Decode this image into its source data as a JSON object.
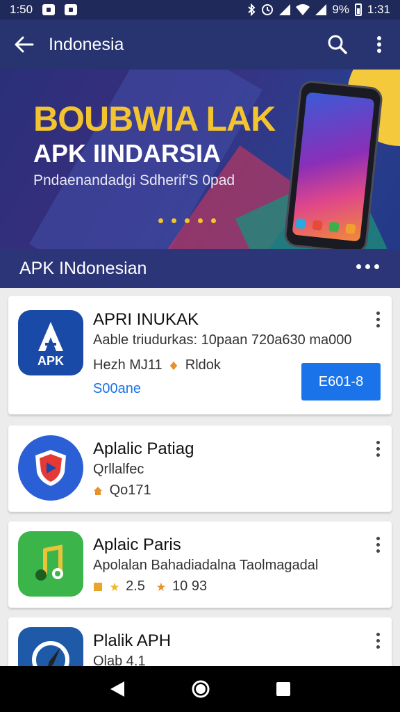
{
  "status_bar": {
    "time_left": "1:50",
    "battery": "9%",
    "time_right": "1:31"
  },
  "app_bar": {
    "title": "Indonesia"
  },
  "banner": {
    "title_line1": "BOUBWIA LAK",
    "title_line2": "APK IINDARSIA",
    "subtitle": "Pndaenandadgi Sdherif'S 0pad"
  },
  "section": {
    "title": "APK INdonesian"
  },
  "apps": [
    {
      "name": "APRI INUKAK",
      "icon_text": "APK",
      "icon": "apk-logo-icon",
      "line1": "Aable triudurkas: 10paan 720a630 ma000",
      "line2": "Hezh MJ11",
      "line2_extra": "Rldok",
      "link": "S00ane",
      "button_label": "E601-8"
    },
    {
      "name": "Aplalic Patiag",
      "icon": "shield-play-icon",
      "line1": "Qrllalfec",
      "rating": "Qo171"
    },
    {
      "name": "Aplaic Paris",
      "icon": "music-note-icon",
      "line1": "Apolalan Bahadiadalna Taolmagadal",
      "stat1": "2.5",
      "stat2": "10 93"
    },
    {
      "name": "Plalik APH",
      "icon": "compass-icon",
      "line1": "Olab 4.1"
    }
  ],
  "colors": {
    "primary_bar": "#283470",
    "accent_button": "#1a73e8",
    "banner_yellow": "#f4c430"
  }
}
